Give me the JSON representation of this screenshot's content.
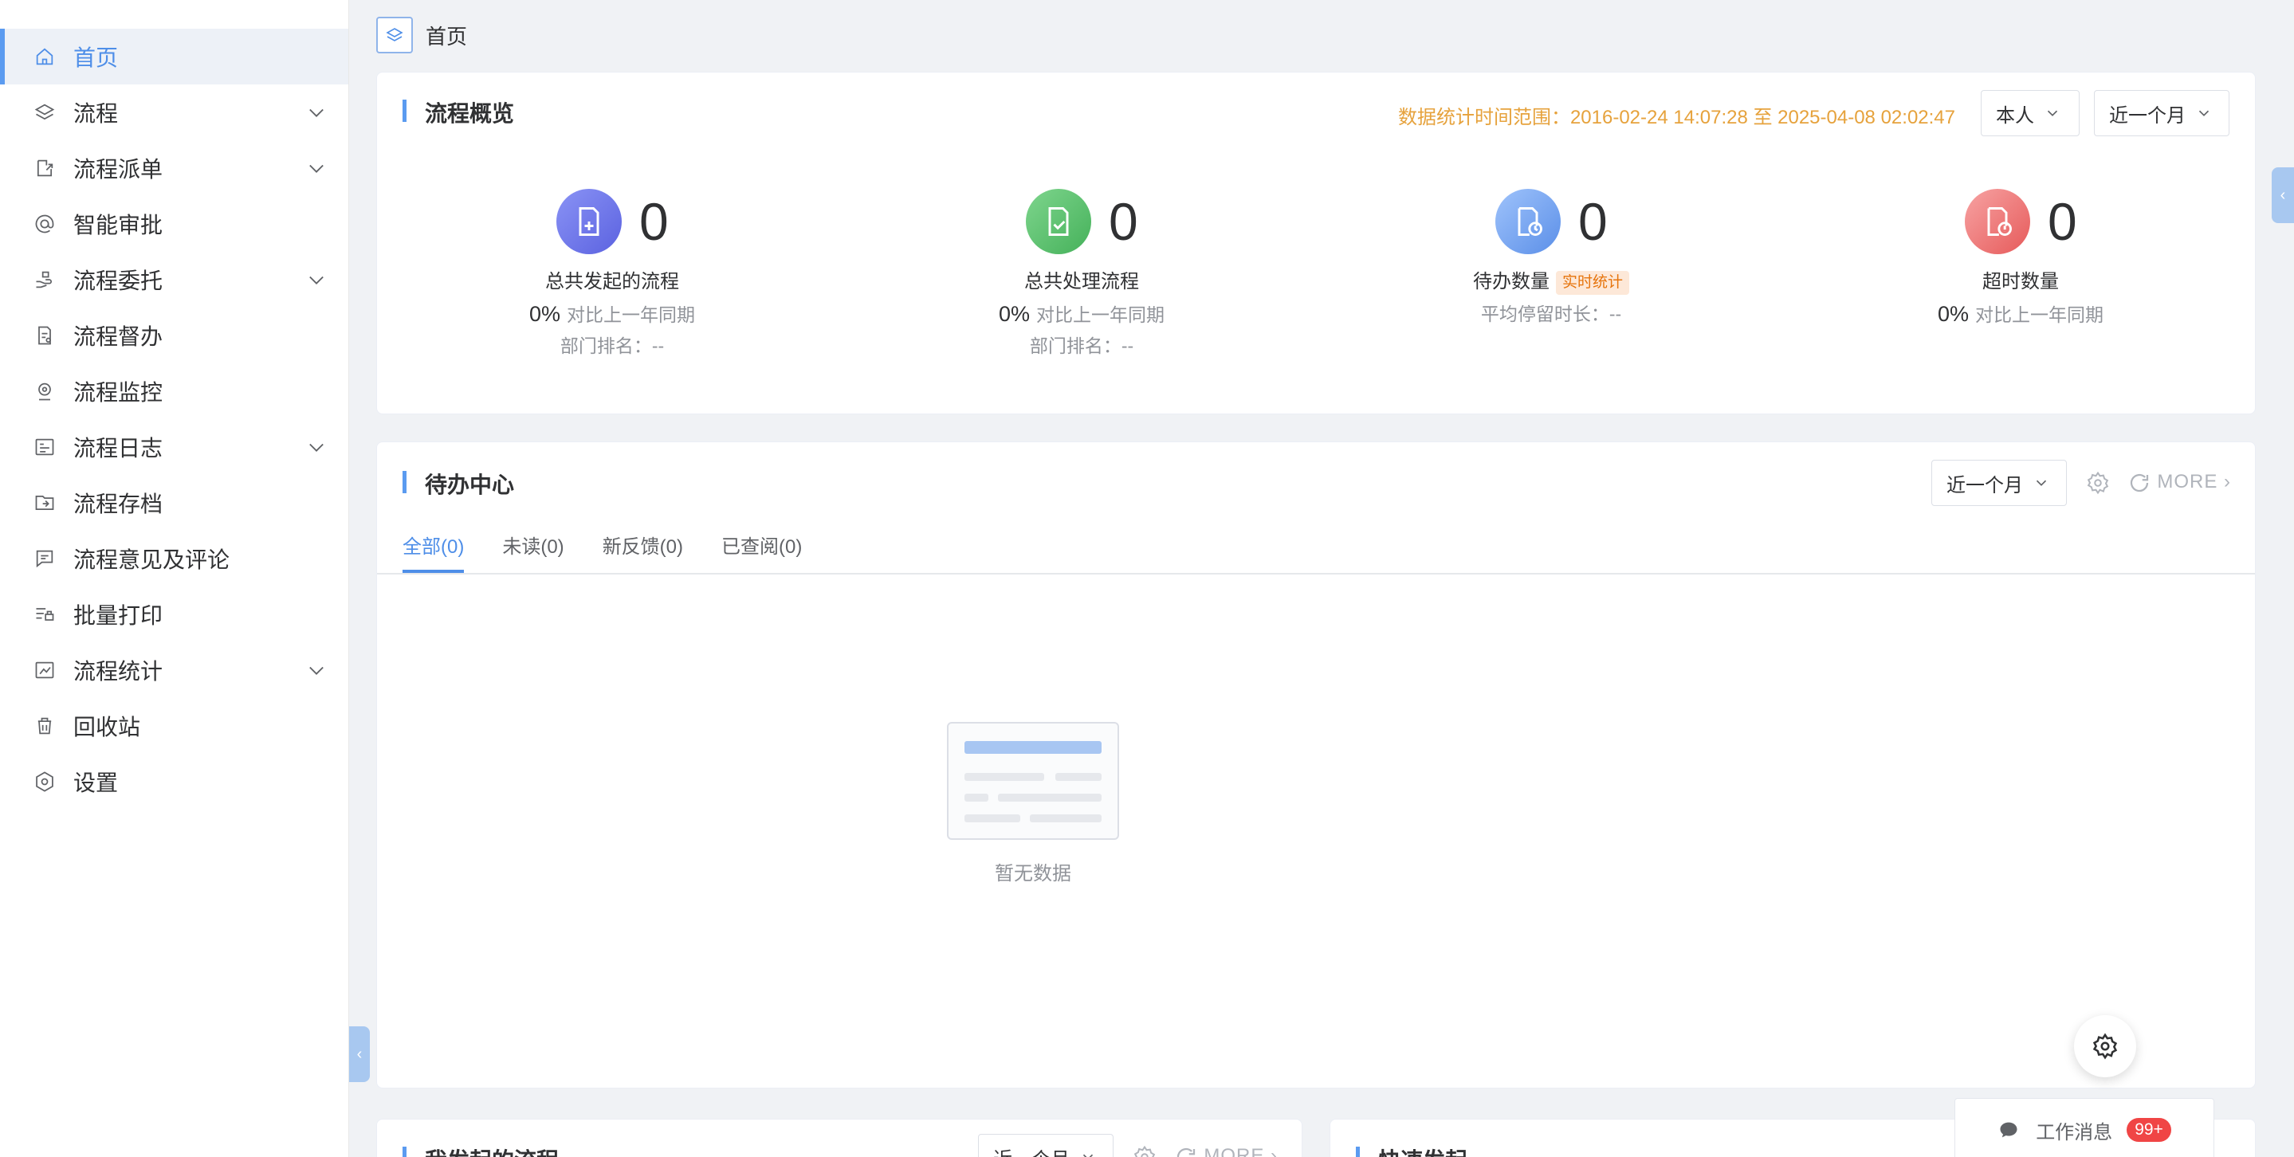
{
  "sidebar": {
    "items": [
      {
        "label": "首页",
        "icon": "home-icon",
        "expandable": false,
        "active": true
      },
      {
        "label": "流程",
        "icon": "layers-icon",
        "expandable": true
      },
      {
        "label": "流程派单",
        "icon": "dispatch-icon",
        "expandable": true
      },
      {
        "label": "智能审批",
        "icon": "at-icon",
        "expandable": false
      },
      {
        "label": "流程委托",
        "icon": "hand-icon",
        "expandable": true
      },
      {
        "label": "流程督办",
        "icon": "supervise-icon",
        "expandable": false
      },
      {
        "label": "流程监控",
        "icon": "monitor-icon",
        "expandable": false
      },
      {
        "label": "流程日志",
        "icon": "log-icon",
        "expandable": true
      },
      {
        "label": "流程存档",
        "icon": "archive-icon",
        "expandable": false
      },
      {
        "label": "流程意见及评论",
        "icon": "comment-icon",
        "expandable": false
      },
      {
        "label": "批量打印",
        "icon": "print-icon",
        "expandable": false
      },
      {
        "label": "流程统计",
        "icon": "stats-icon",
        "expandable": true
      },
      {
        "label": "回收站",
        "icon": "trash-icon",
        "expandable": false
      },
      {
        "label": "设置",
        "icon": "settings-icon",
        "expandable": false
      }
    ]
  },
  "breadcrumb": {
    "label": "首页"
  },
  "overview": {
    "title": "流程概览",
    "range_text": "数据统计时间范围：2016-02-24 14:07:28 至 2025-04-08 02:02:47",
    "scope_select": "本人",
    "period_select": "近一个月",
    "stats": [
      {
        "value": "0",
        "label": "总共发起的流程",
        "pct": "0%",
        "compare": "对比上一年同期",
        "rank": "部门排名：--",
        "color": "#6b74e8"
      },
      {
        "value": "0",
        "label": "总共处理流程",
        "pct": "0%",
        "compare": "对比上一年同期",
        "rank": "部门排名：--",
        "color": "#55bd6a"
      },
      {
        "value": "0",
        "label": "待办数量",
        "badge": "实时统计",
        "sub": "平均停留时长：--",
        "color": "#6a9ef0"
      },
      {
        "value": "0",
        "label": "超时数量",
        "pct": "0%",
        "compare": "对比上一年同期",
        "color": "#ee6c6c"
      }
    ]
  },
  "todo": {
    "title": "待办中心",
    "period_select": "近一个月",
    "more": "MORE",
    "tabs": [
      "全部(0)",
      "未读(0)",
      "新反馈(0)",
      "已查阅(0)"
    ],
    "empty_text": "暂无数据"
  },
  "my_flows": {
    "title": "我发起的流程",
    "period_select": "近一个月",
    "more": "MORE"
  },
  "quick_start": {
    "title": "快速发起"
  },
  "messages": {
    "label": "工作消息",
    "badge": "99+"
  }
}
